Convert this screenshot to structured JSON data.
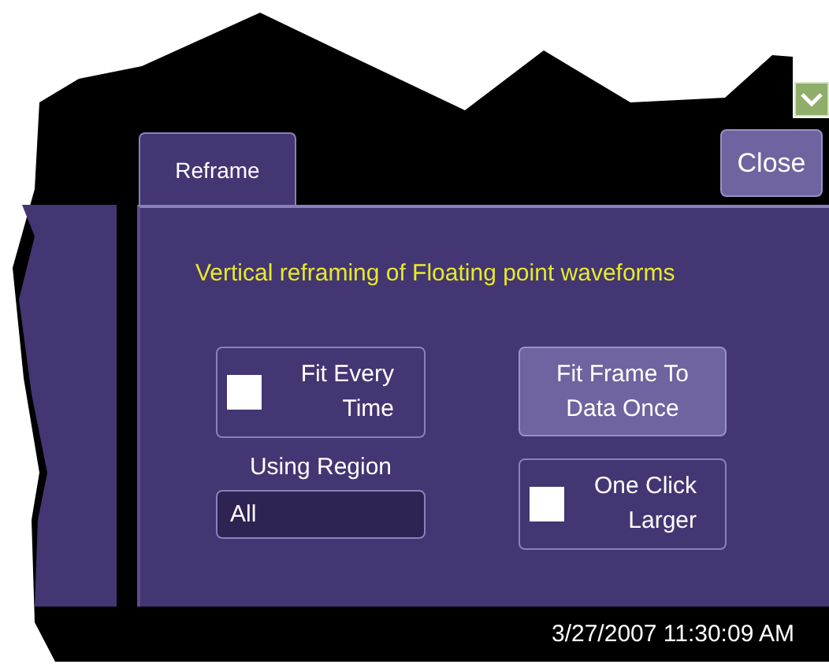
{
  "tabs": [
    {
      "label": "Reframe",
      "selected": true
    }
  ],
  "close_button": "Close",
  "title": "Vertical reframing of Floating point waveforms",
  "controls": [
    {
      "kind": "checkbox",
      "label": "Fit Every Time",
      "checked": false
    },
    {
      "kind": "button",
      "label": "Fit Frame To Data Once"
    },
    {
      "kind": "field",
      "label": "Using Region",
      "value": "All"
    },
    {
      "kind": "checkbox",
      "label": "One Click Larger",
      "checked": false
    }
  ],
  "status_bar": {
    "datetime": "3/27/2007 11:30:09 AM"
  }
}
